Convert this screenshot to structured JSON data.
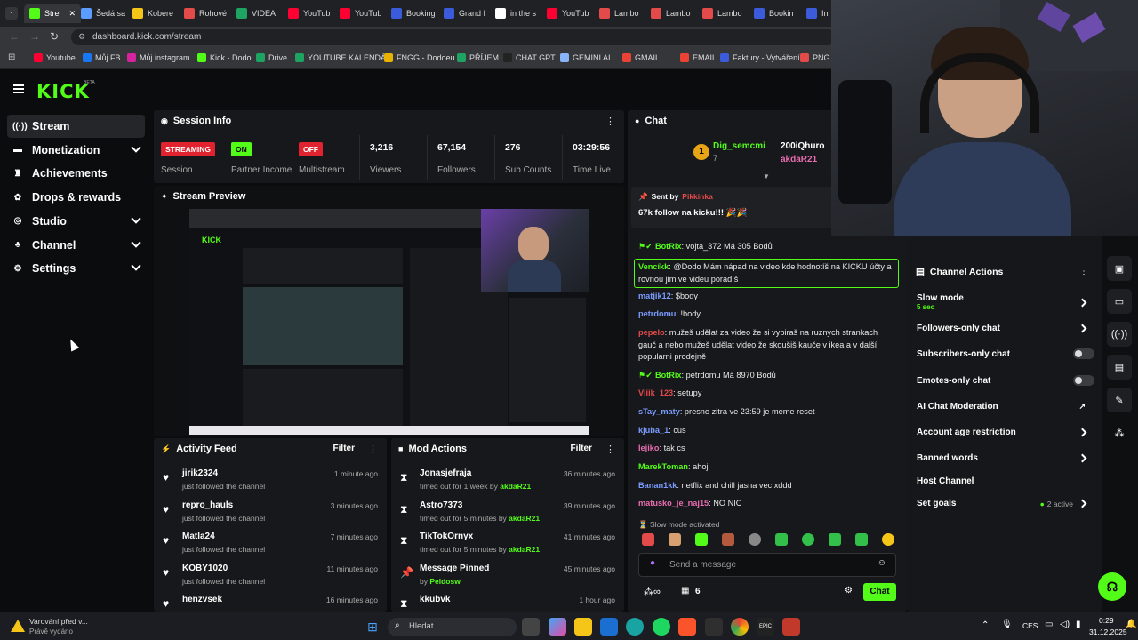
{
  "browser": {
    "tabs": [
      {
        "label": "Stre",
        "color": "#53fc18"
      },
      {
        "label": "Šedá sa",
        "color": "#5b9cff"
      },
      {
        "label": "Kobere",
        "color": "#f5c518"
      },
      {
        "label": "Rohové",
        "color": "#e34a4a"
      },
      {
        "label": "VIDEA",
        "color": "#1ea362"
      },
      {
        "label": "YouTub",
        "color": "#ff0033"
      },
      {
        "label": "YouTub",
        "color": "#ff0033"
      },
      {
        "label": "Booking",
        "color": "#3b5bdb"
      },
      {
        "label": "Grand I",
        "color": "#3b5bdb"
      },
      {
        "label": "in the s",
        "color": "#ffffff"
      },
      {
        "label": "YouTub",
        "color": "#ff0033"
      },
      {
        "label": "Lambo",
        "color": "#e34a4a"
      },
      {
        "label": "Lambo",
        "color": "#e34a4a"
      },
      {
        "label": "Lambo",
        "color": "#e34a4a"
      },
      {
        "label": "Bookin",
        "color": "#3b5bdb"
      },
      {
        "label": "In",
        "color": "#3b5bdb"
      }
    ],
    "url": "dashboard.kick.com/stream",
    "bookmarks": [
      {
        "label": "Youtube",
        "color": "#ff0033"
      },
      {
        "label": "Můj FB",
        "color": "#1877f2"
      },
      {
        "label": "Můj instagram",
        "color": "#d6249f"
      },
      {
        "label": "Kick - Dodo",
        "color": "#53fc18"
      },
      {
        "label": "Drive",
        "color": "#1ea362"
      },
      {
        "label": "YOUTUBE KALENDÁŘ",
        "color": "#1ea362"
      },
      {
        "label": "FNGG - Dodoeu",
        "color": "#e8b200"
      },
      {
        "label": "PŘÍJEM",
        "color": "#1ea362"
      },
      {
        "label": "CHAT GPT",
        "color": "#222222"
      },
      {
        "label": "GEMINI AI",
        "color": "#8ab4f8"
      },
      {
        "label": "GMAIL",
        "color": "#ea4335"
      },
      {
        "label": "EMAIL",
        "color": "#ea4335"
      },
      {
        "label": "Faktury - Vytváření",
        "color": "#3b5bdb"
      },
      {
        "label": "PNG",
        "color": "#e34a4a"
      }
    ]
  },
  "brand": {
    "logo": "KICK",
    "beta": "BETA",
    "accent": "#53fc18"
  },
  "sidebar": {
    "items": [
      {
        "label": "Stream",
        "icon": "broadcast-icon",
        "active": true,
        "chevron": false
      },
      {
        "label": "Monetization",
        "icon": "monetization-icon",
        "chevron": true
      },
      {
        "label": "Achievements",
        "icon": "trophy-icon",
        "chevron": false
      },
      {
        "label": "Drops & rewards",
        "icon": "gift-icon",
        "chevron": false
      },
      {
        "label": "Studio",
        "icon": "studio-icon",
        "chevron": true
      },
      {
        "label": "Channel",
        "icon": "channel-icon",
        "chevron": true
      },
      {
        "label": "Settings",
        "icon": "gear-icon",
        "chevron": true
      }
    ]
  },
  "session_info": {
    "title": "Session Info",
    "stats": [
      {
        "value": "STREAMING",
        "label": "Session",
        "kind": "badge",
        "color": "#e0232e"
      },
      {
        "value": "ON",
        "label": "Partner Income",
        "kind": "badge",
        "color": "#53fc18"
      },
      {
        "value": "OFF",
        "label": "Multistream",
        "kind": "badge",
        "color": "#e0232e"
      },
      {
        "value": "3,216",
        "label": "Viewers"
      },
      {
        "value": "67,154",
        "label": "Followers"
      },
      {
        "value": "276",
        "label": "Sub Counts"
      },
      {
        "value": "03:29:56",
        "label": "Time Live"
      }
    ]
  },
  "stream_preview": {
    "title": "Stream Preview"
  },
  "activity_feed": {
    "title": "Activity Feed",
    "filter": "Filter",
    "items": [
      {
        "name": "jirik2324",
        "sub": "just followed the channel",
        "time": "1 minute ago"
      },
      {
        "name": "repro_hauls",
        "sub": "just followed the channel",
        "time": "3 minutes ago"
      },
      {
        "name": "Matla24",
        "sub": "just followed the channel",
        "time": "7 minutes ago"
      },
      {
        "name": "KOBY1020",
        "sub": "just followed the channel",
        "time": "11 minutes ago"
      },
      {
        "name": "henzvsek",
        "sub": "",
        "time": "16 minutes ago"
      }
    ]
  },
  "mod_actions": {
    "title": "Mod Actions",
    "filter": "Filter",
    "items": [
      {
        "name": "Jonasjefraja",
        "sub": "timed out for 1 week by",
        "by": "akdaR21",
        "time": "36 minutes ago",
        "icon": "hourglass-icon"
      },
      {
        "name": "Astro7373",
        "sub": "timed out for 5 minutes by",
        "by": "akdaR21",
        "time": "39 minutes ago",
        "icon": "hourglass-icon"
      },
      {
        "name": "TikTokOrnyx",
        "sub": "timed out for 5 minutes by",
        "by": "akdaR21",
        "time": "41 minutes ago",
        "icon": "hourglass-icon"
      },
      {
        "name": "Message Pinned",
        "sub": "by",
        "by": "Peldosw",
        "time": "45 minutes ago",
        "icon": "pin-icon"
      },
      {
        "name": "kkubvk",
        "sub": "",
        "by": "",
        "time": "1 hour ago",
        "icon": "hourglass-icon"
      }
    ]
  },
  "chat": {
    "title": "Chat",
    "top_gifter": {
      "rank": "1",
      "name": "Dig_semcmi",
      "count": "7",
      "second": "200iQhuro",
      "third": "akdaR21"
    },
    "pinned": {
      "sent_by_label": "Sent by",
      "sender": "Pikkinka",
      "text": "67k follow na kicku!!! 🎉🎉"
    },
    "messages": [
      {
        "user": "BotRix",
        "text": ": vojta_372 Má 305 Bodů",
        "color": "#53fc18",
        "bot": true
      },
      {
        "user": "Vencíkk",
        "text": ": @Dodo Mám nápad na video kde hodnotíš na KICKU účty a rovnou jim ve videu poradíš",
        "color": "#53fc18",
        "highlight": true
      },
      {
        "user": "matjik12",
        "text": ": $body",
        "color": "#7b9cff"
      },
      {
        "user": "petrdomu",
        "text": ": !body",
        "color": "#7b9cff"
      },
      {
        "user": "pepelo",
        "text": ": mužeš udělat za video že si vybiraš na ruznych strankach gauč a nebo mužeš udělat video že skoušiš kauče v ikea a v další popularni prodejně",
        "color": "#e34a4a"
      },
      {
        "user": "BotRix",
        "text": ": petrdomu Má 8970 Bodů",
        "color": "#53fc18",
        "bot": true
      },
      {
        "user": "Viiik_123",
        "text": ": setupy",
        "color": "#e34a4a"
      },
      {
        "user": "sTay_maty",
        "text": ": presne zitra ve 23:59 je meme reset",
        "color": "#7b9cff"
      },
      {
        "user": "kjuba_1",
        "text": ": cus",
        "color": "#7b9cff"
      },
      {
        "user": "lejiko",
        "text": ": tak cs",
        "color": "#e86db0"
      },
      {
        "user": "MarekToman",
        "text": ": ahoj",
        "color": "#53fc18"
      },
      {
        "user": "Banan1kk",
        "text": ": netflix and chill jasna vec xddd",
        "color": "#7b9cff"
      },
      {
        "user": "matusko_je_naj15",
        "text": ": NO NIC",
        "color": "#e86db0"
      }
    ],
    "slow_mode_notice": "Slow mode activated",
    "input_placeholder": "Send a message",
    "footer_count": "6",
    "send_label": "Chat"
  },
  "channel_actions": {
    "title": "Channel Actions",
    "items": [
      {
        "label": "Slow mode",
        "sub": "5 sec",
        "control": "arrow"
      },
      {
        "label": "Followers-only chat",
        "control": "arrow"
      },
      {
        "label": "Subscribers-only chat",
        "control": "toggle"
      },
      {
        "label": "Emotes-only chat",
        "control": "toggle"
      },
      {
        "label": "AI Chat Moderation",
        "control": "external"
      },
      {
        "label": "Account age restriction",
        "control": "arrow"
      },
      {
        "label": "Banned words",
        "control": "arrow"
      },
      {
        "label": "Host Channel",
        "control": "none"
      },
      {
        "label": "Set goals",
        "control": "arrow",
        "status": "2 active"
      }
    ]
  },
  "taskbar": {
    "notification_title": "Varování před v...",
    "notification_sub": "Právě vydáno",
    "search_placeholder": "Hledat",
    "lang": "CES",
    "time": "0:29",
    "date": "31.12.2025"
  }
}
